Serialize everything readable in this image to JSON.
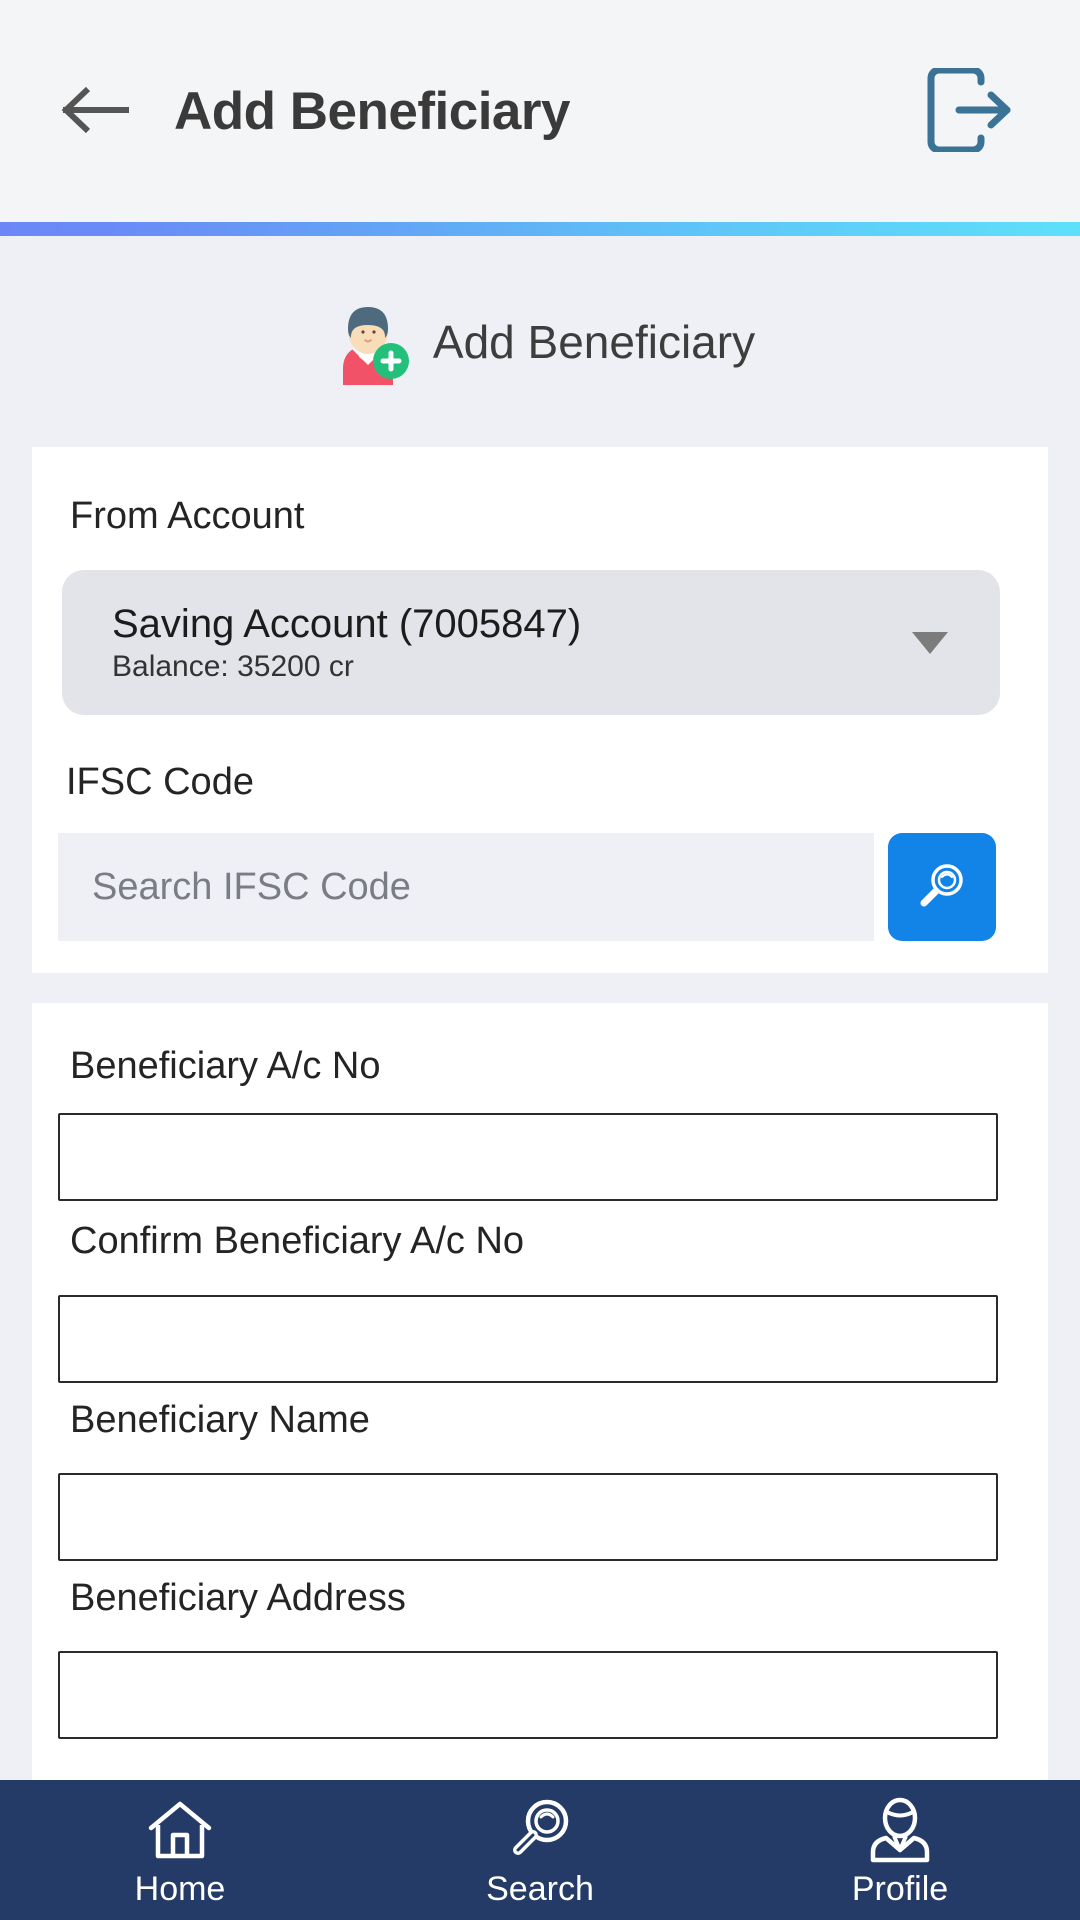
{
  "appbar": {
    "back_icon": "arrow-left-icon",
    "title": "Add Beneficiary",
    "logout_icon": "logout-icon",
    "background": "#f4f5f7",
    "title_color": "#3a3a3a"
  },
  "gradient": {
    "from": "#6b87f7",
    "to": "#5ee0fb"
  },
  "section": {
    "icon": "add-beneficiary-avatar-icon",
    "title": "Add Beneficiary"
  },
  "form": {
    "from_account": {
      "label": "From Account",
      "selected_account": "Saving Account (7005847)",
      "balance": "Balance: 35200 cr",
      "caret_icon": "chevron-down-icon",
      "options": [
        "Saving Account (7005847)"
      ]
    },
    "ifsc": {
      "label": "IFSC Code",
      "placeholder": "Search IFSC Code",
      "value": "",
      "search_icon": "search-icon",
      "button_color": "#1284e8"
    },
    "fields": [
      {
        "label": "Beneficiary A/c No",
        "value": "",
        "placeholder": ""
      },
      {
        "label": "Confirm Beneficiary A/c No",
        "value": "",
        "placeholder": ""
      },
      {
        "label": "Beneficiary Name",
        "value": "",
        "placeholder": ""
      },
      {
        "label": "Beneficiary Address",
        "value": "",
        "placeholder": ""
      }
    ]
  },
  "bottomnav": {
    "background": "#243b68",
    "items": [
      {
        "label": "Home",
        "icon": "home-icon"
      },
      {
        "label": "Search",
        "icon": "search-icon"
      },
      {
        "label": "Profile",
        "icon": "profile-icon"
      }
    ]
  }
}
